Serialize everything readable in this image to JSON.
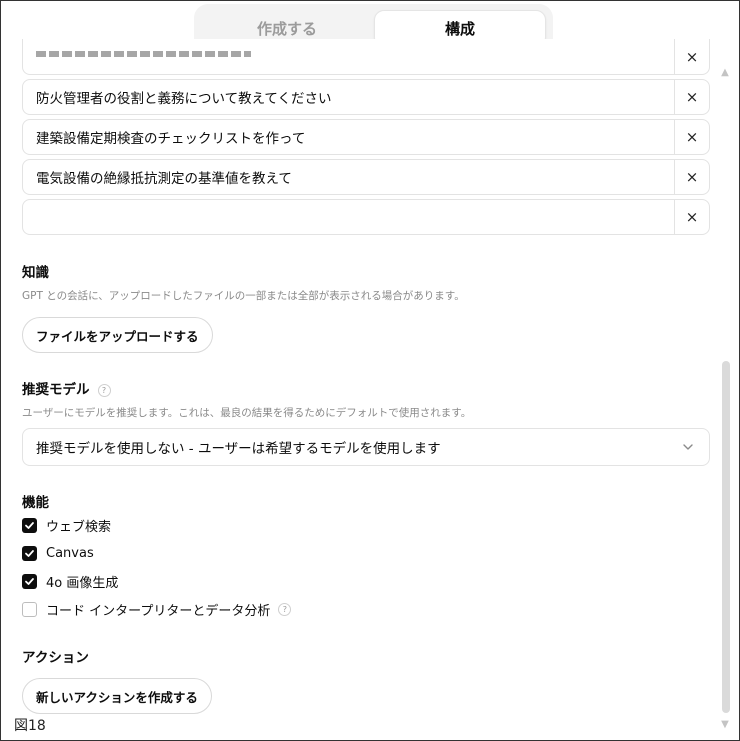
{
  "tabs": [
    {
      "label": "作成する",
      "active": false
    },
    {
      "label": "構成",
      "active": true
    }
  ],
  "conversation_starters": [
    {
      "text": "防火管理者の役割と義務について教えてください"
    },
    {
      "text": "建築設備定期検査のチェックリストを作って"
    },
    {
      "text": "電気設備の絶縁抵抗測定の基準値を教えて"
    },
    {
      "text": ""
    }
  ],
  "remove_glyph": "×",
  "knowledge": {
    "title": "知識",
    "description": "GPT との会話に、アップロードしたファイルの一部または全部が表示される場合があります。",
    "upload_button": "ファイルをアップロードする"
  },
  "recommended_model": {
    "title": "推奨モデル",
    "help_glyph": "?",
    "description": "ユーザーにモデルを推奨します。これは、最良の結果を得るためにデフォルトで使用されます。",
    "selected": "推奨モデルを使用しない - ユーザーは希望するモデルを使用します"
  },
  "capabilities": {
    "title": "機能",
    "items": [
      {
        "label": "ウェブ検索",
        "checked": true
      },
      {
        "label": "Canvas",
        "checked": true
      },
      {
        "label": "4o 画像生成",
        "checked": true
      },
      {
        "label": "コード インタープリターとデータ分析",
        "checked": false,
        "help": true
      }
    ]
  },
  "actions": {
    "title": "アクション",
    "new_button": "新しいアクションを作成する"
  },
  "figure_caption": "図18",
  "colors": {
    "text": "#0d0d0d",
    "muted": "#8a8a8a",
    "border": "#e3e3e3",
    "checkbox_on": "#0d0d0d",
    "tab_bg": "#f3f3f3"
  }
}
